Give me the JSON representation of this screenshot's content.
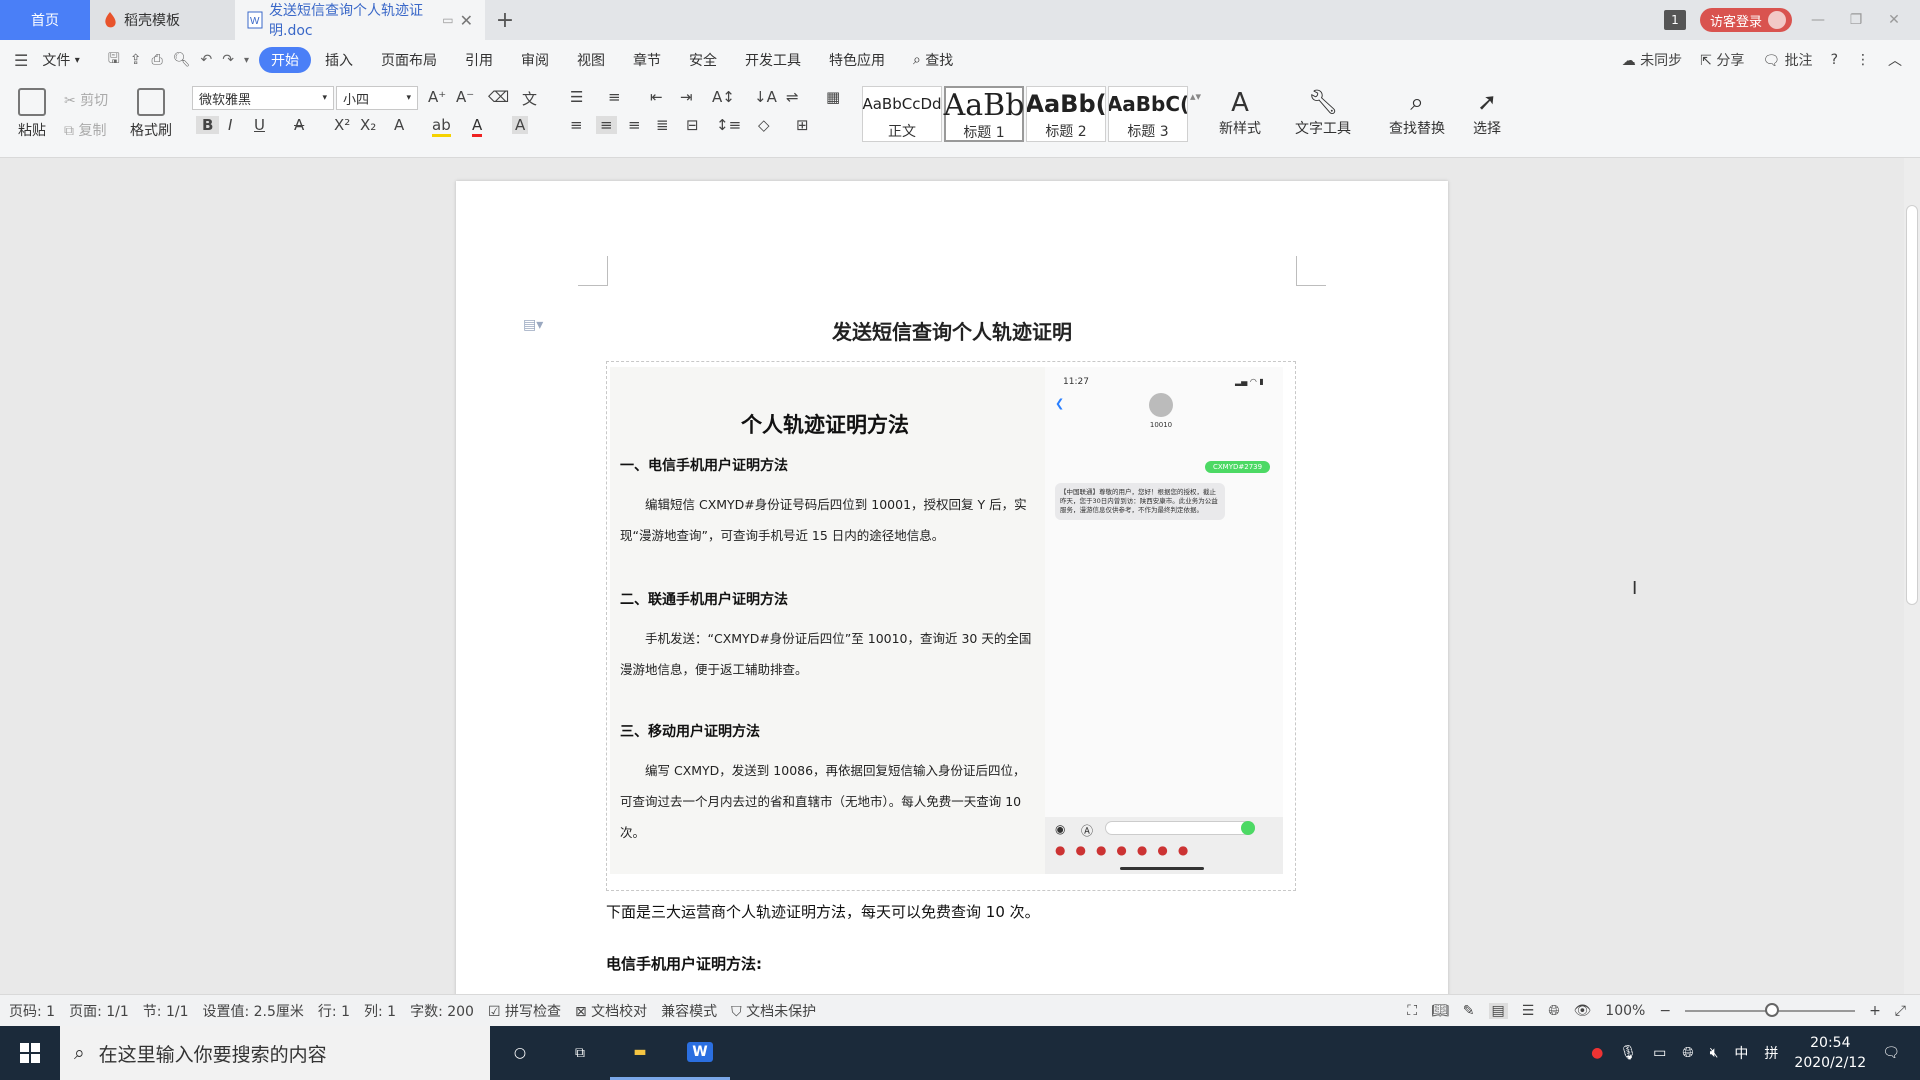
{
  "tabs": {
    "home": "首页",
    "template": "稻壳模板",
    "doc": "发送短信查询个人轨迹证明.doc"
  },
  "titlebar": {
    "window_count": "1",
    "login": "访客登录"
  },
  "menu": {
    "file": "文件",
    "items": [
      "开始",
      "插入",
      "页面布局",
      "引用",
      "审阅",
      "视图",
      "章节",
      "安全",
      "开发工具",
      "特色应用"
    ],
    "find": "查找",
    "sync": "未同步",
    "share": "分享",
    "comment": "批注"
  },
  "ribbon": {
    "paste": "粘贴",
    "cut": "剪切",
    "copy": "复制",
    "format_painter": "格式刷",
    "font": "微软雅黑",
    "size": "小四",
    "styles": [
      {
        "preview": "AaBbCcDd",
        "name": "正文"
      },
      {
        "preview": "AaBb",
        "name": "标题 1"
      },
      {
        "preview": "AaBb(",
        "name": "标题 2"
      },
      {
        "preview": "AaBbC(",
        "name": "标题 3"
      }
    ],
    "new_style": "新样式",
    "text_tools": "文字工具",
    "find_replace": "查找替换",
    "select": "选择"
  },
  "document": {
    "title": "发送短信查询个人轨迹证明",
    "image": {
      "heading": "个人轨迹证明方法",
      "sections": [
        {
          "title": "一、电信手机用户证明方法",
          "text": "编辑短信 CXMYD#身份证号码后四位到 10001，授权回复 Y 后，实现“漫游地查询”，可查询手机号近 15 日内的途径地信息。"
        },
        {
          "title": "二、联通手机用户证明方法",
          "text": "手机发送：“CXMYD#身份证后四位”至 10010，查询近 30 天的全国漫游地信息，便于返工辅助排查。"
        },
        {
          "title": "三、移动用户证明方法",
          "text": "编写 CXMYD，发送到 10086，再依据回复短信输入身份证后四位，可查询过去一个月内去过的省和直辖市（无地市）。每人免费一天查询 10 次。"
        }
      ],
      "phone": {
        "time": "11:27",
        "contact": "10010",
        "sent": "CXMYD#2739",
        "reply": "【中国联通】尊敬的用户，您好！根据您的授权，截止昨天，您于30日内曾到访：陕西安康市。此业务为公益服务，漫游信息仅供参考，不作为最终判定依据。"
      }
    },
    "para1": "下面是三大运营商个人轨迹证明方法，每天可以免费查询 10 次。",
    "para2": "电信手机用户证明方法:"
  },
  "status": {
    "page": "页码: 1",
    "pages": "页面: 1/1",
    "section": "节: 1/1",
    "setting": "设置值: 2.5厘米",
    "row": "行: 1",
    "col": "列: 1",
    "words": "字数: 200",
    "spell": "拼写检查",
    "proof": "文档校对",
    "compat": "兼容模式",
    "protect": "文档未保护",
    "zoom": "100%"
  },
  "taskbar": {
    "search": "在这里输入你要搜索的内容",
    "ime": "中",
    "time": "20:54",
    "date": "2020/2/12"
  },
  "colors": {
    "accent": "#4a7ff7",
    "login": "#d9534f",
    "taskbar": "#1b2a3a"
  }
}
